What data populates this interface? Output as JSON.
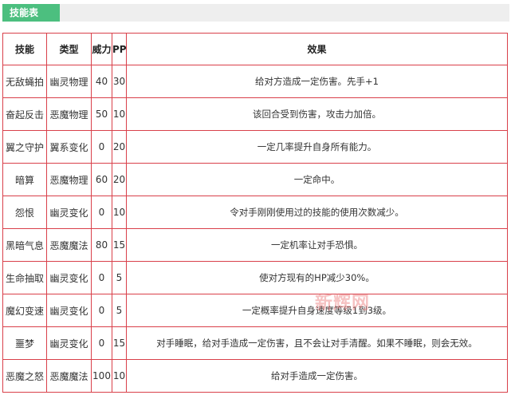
{
  "header": {
    "tab_label": "技能表"
  },
  "table": {
    "columns": [
      "技能",
      "类型",
      "威力",
      "PP",
      "效果"
    ],
    "rows": [
      {
        "name": "无敌蝇拍",
        "type": "幽灵物理",
        "power": "40",
        "pp": "30",
        "effect": "给对方造成一定伤害。先手+1"
      },
      {
        "name": "奋起反击",
        "type": "恶魔物理",
        "power": "50",
        "pp": "10",
        "effect": "该回合受到伤害，攻击力加倍。"
      },
      {
        "name": "翼之守护",
        "type": "翼系变化",
        "power": "0",
        "pp": "20",
        "effect": "一定几率提升自身所有能力。"
      },
      {
        "name": "暗算",
        "type": "恶魔物理",
        "power": "60",
        "pp": "20",
        "effect": "一定命中。"
      },
      {
        "name": "怨恨",
        "type": "幽灵变化",
        "power": "0",
        "pp": "10",
        "effect": "令对手刚刚使用过的技能的使用次数减少。"
      },
      {
        "name": "黑暗气息",
        "type": "恶魔魔法",
        "power": "80",
        "pp": "15",
        "effect": "一定机率让对手恐惧。"
      },
      {
        "name": "生命抽取",
        "type": "幽灵变化",
        "power": "0",
        "pp": "5",
        "effect": "使对方现有的HP减少30%。"
      },
      {
        "name": "魔幻变速",
        "type": "幽灵变化",
        "power": "0",
        "pp": "5",
        "effect": "一定概率提升自身速度等级1到3级。"
      },
      {
        "name": "噩梦",
        "type": "幽灵变化",
        "power": "0",
        "pp": "15",
        "effect": "对手睡眠，给对手造成一定伤害，且不会让对手清醒。如果不睡眠，则会无效。"
      },
      {
        "name": "恶魔之怒",
        "type": "恶魔魔法",
        "power": "100",
        "pp": "10",
        "effect": "给对手造成一定伤害。"
      }
    ]
  },
  "watermark": {
    "text": "新辉网"
  }
}
